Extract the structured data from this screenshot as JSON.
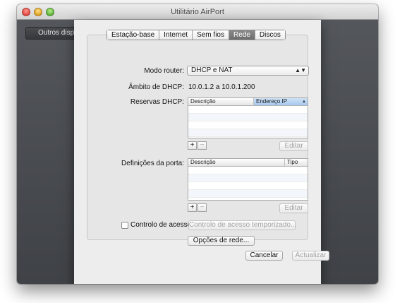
{
  "window": {
    "title": "Utilitário AirPort",
    "other_devices_label": "Outros disp"
  },
  "tabs": [
    {
      "label": "Estação-base",
      "selected": false
    },
    {
      "label": "Internet",
      "selected": false
    },
    {
      "label": "Sem fios",
      "selected": false
    },
    {
      "label": "Rede",
      "selected": true
    },
    {
      "label": "Discos",
      "selected": false
    }
  ],
  "router_mode": {
    "label": "Modo router:",
    "value": "DHCP e NAT"
  },
  "dhcp_range": {
    "label": "Âmbito de DHCP:",
    "value": "10.0.1.2 a 10.0.1.200"
  },
  "dhcp_reservations": {
    "label": "Reservas DHCP:",
    "columns": [
      "Descrição",
      "Endereço IP"
    ],
    "rows": [],
    "add_label": "+",
    "remove_label": "−",
    "edit_label": "Editar"
  },
  "port_settings": {
    "label": "Definições da porta:",
    "columns": [
      "Descrição",
      "Tipo"
    ],
    "rows": [],
    "add_label": "+",
    "remove_label": "−",
    "edit_label": "Editar"
  },
  "access_control": {
    "label": "Controlo de acesso:",
    "checked": false,
    "timed_button_label": "Controlo de acesso temporizado..."
  },
  "network_options_label": "Opções de rede...",
  "footer": {
    "cancel_label": "Cancelar",
    "update_label": "Actualizar"
  }
}
